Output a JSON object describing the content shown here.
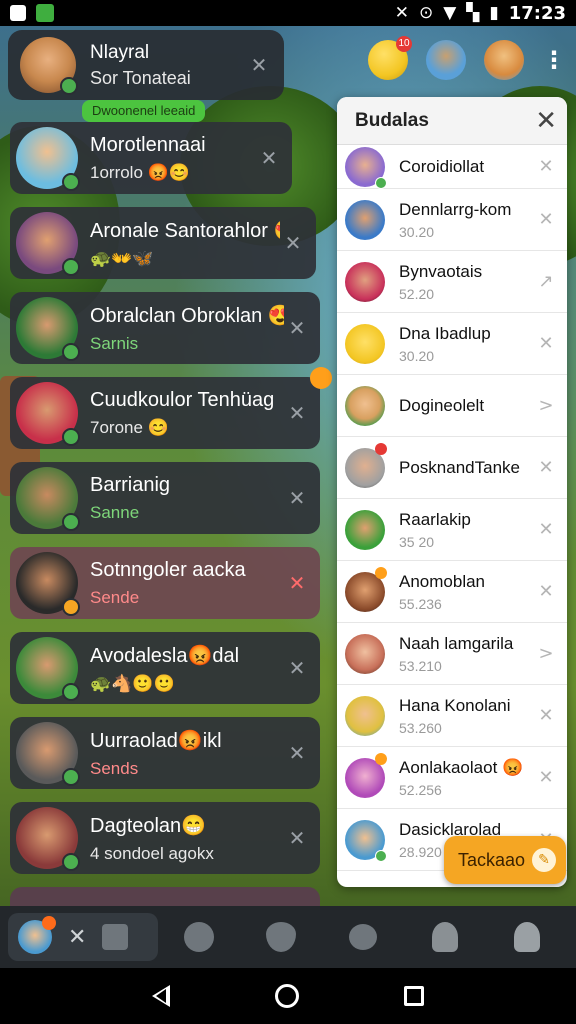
{
  "status_bar": {
    "time": "17:23"
  },
  "top_chip": {
    "title": "Nlayral",
    "subtitle": "Sor Tonateai",
    "avatar_color": "#c8884e"
  },
  "green_tag": "Dwoonenel leeaid",
  "top_icons": [
    {
      "name": "emoji-face",
      "color": "#f3c623",
      "badge": "10"
    },
    {
      "name": "avatar-2",
      "color": "#5aa0d8"
    },
    {
      "name": "avatar-3",
      "color": "#d88a3e"
    }
  ],
  "left_list": [
    {
      "name": "Morotlennaai",
      "meta": "1orrolo 😡😊",
      "meta_style": "white",
      "avatar": "#6cbde0"
    },
    {
      "name": "Aronale Santorahlor 😍",
      "meta": "🐢👐🦋",
      "meta_style": "white",
      "avatar": "#7a4a7e"
    },
    {
      "name": "Obralclan Obroklan 😍",
      "meta": "Sarnis",
      "meta_style": "green",
      "avatar": "#2d7a36"
    },
    {
      "name": "Cuudkoulor Tenhüag",
      "meta": "7orone 😊",
      "meta_style": "white",
      "avatar": "#c8304a"
    },
    {
      "name": "Barrianig",
      "meta": "Sanne",
      "meta_style": "green",
      "avatar": "#4b7a3a"
    },
    {
      "name": "Sotnngoler aacka",
      "meta": "Sende",
      "meta_style": "red",
      "avatar": "#2a2a2a",
      "highlight": true
    },
    {
      "name": "Avodalesla😡dal",
      "meta": "🐢🐴🙂🙂",
      "meta_style": "white",
      "avatar": "#3c8a3a"
    },
    {
      "name": "Uurraolad😡ikl",
      "meta": "Sends",
      "meta_style": "red",
      "avatar": "#5a5a5a"
    },
    {
      "name": "Dagteolan😁",
      "meta": "4 sondoel agokx",
      "meta_style": "white",
      "avatar": "#8a3a3a"
    }
  ],
  "buddies": {
    "title": "Budalas",
    "items": [
      {
        "name": "Coroidiollat",
        "num": "",
        "avatar": "#8a6ad0",
        "action": "✕"
      },
      {
        "name": "Dennlarrg-kom",
        "num": "30.20",
        "avatar": "#3a7ac8",
        "action": "✕"
      },
      {
        "name": "Bynvaotais",
        "num": "52.20",
        "avatar": "#c8305a",
        "action": "↗"
      },
      {
        "name": "Dna Ibadlup",
        "num": "30.20",
        "avatar": "#f3c623",
        "action": "✕"
      },
      {
        "name": "Dogineolelt",
        "num": "",
        "avatar": "#d8a060",
        "action": ">"
      },
      {
        "name": "PosknandTanke",
        "num": "",
        "avatar": "#a0a0a0",
        "action": "✕"
      },
      {
        "name": "Raarlakip",
        "num": "35 20",
        "avatar": "#3aa03a",
        "action": "✕"
      },
      {
        "name": "Anomoblan",
        "num": "55.236",
        "avatar": "#8a4a2a",
        "action": "✕"
      },
      {
        "name": "Naah lamgarila",
        "num": "53.210",
        "avatar": "#c8705a",
        "action": ">"
      },
      {
        "name": "Hana Konolani",
        "num": "53.260",
        "avatar": "#e0c040",
        "action": "✕"
      },
      {
        "name": "Aonlakaolaot 😡",
        "num": "52.256",
        "avatar": "#b04ab8",
        "action": "✕"
      },
      {
        "name": "Dasicklarolad",
        "num": "28.920",
        "avatar": "#4a9ad0",
        "action": "✕"
      }
    ]
  },
  "float_button": "Tackaao",
  "colors": {
    "accent_orange": "#f5a623",
    "online_green": "#4caf50",
    "badge_red": "#e53935"
  }
}
